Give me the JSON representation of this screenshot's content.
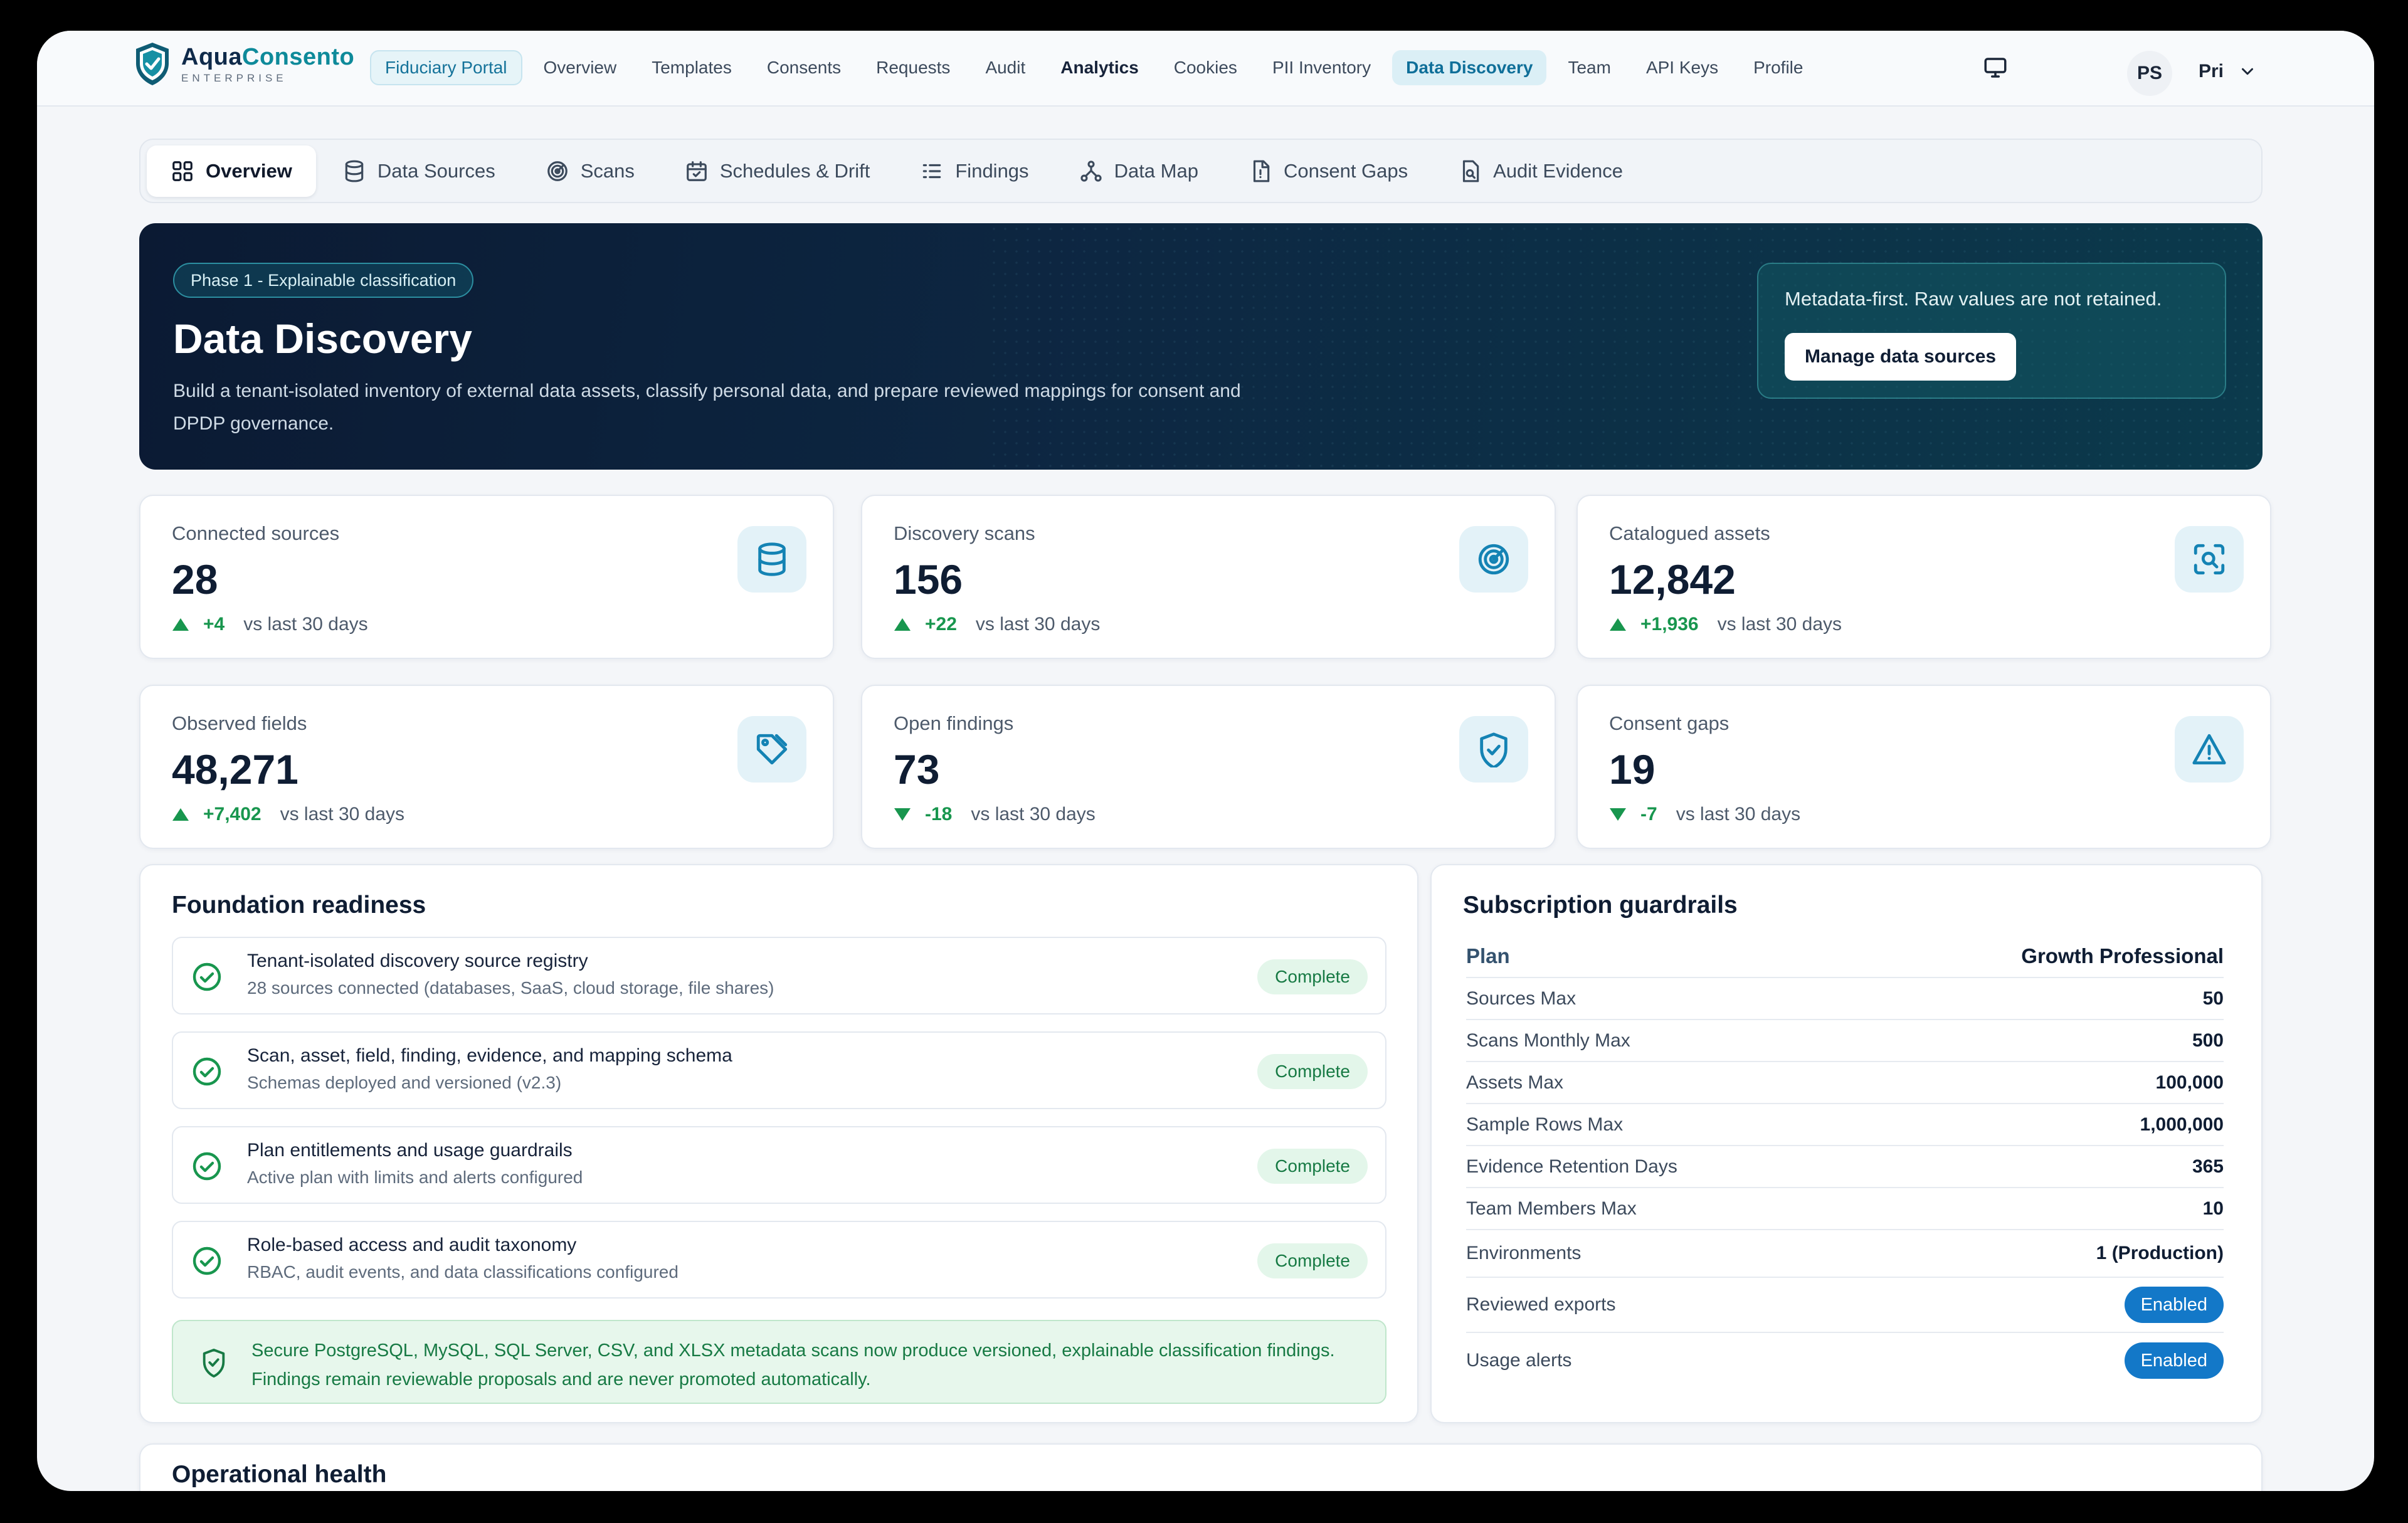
{
  "brand": {
    "name_a": "Aqua",
    "name_b": "Consento",
    "sub": "ENTERPRISE"
  },
  "nav": {
    "items": [
      {
        "label": "Fiduciary Portal",
        "style": "pill"
      },
      {
        "label": "Overview",
        "style": ""
      },
      {
        "label": "Templates",
        "style": ""
      },
      {
        "label": "Consents",
        "style": ""
      },
      {
        "label": "Requests",
        "style": ""
      },
      {
        "label": "Audit",
        "style": ""
      },
      {
        "label": "Analytics",
        "style": "bold"
      },
      {
        "label": "Cookies",
        "style": ""
      },
      {
        "label": "PII Inventory",
        "style": ""
      },
      {
        "label": "Data Discovery",
        "style": "active"
      },
      {
        "label": "Team",
        "style": ""
      },
      {
        "label": "API Keys",
        "style": ""
      },
      {
        "label": "Profile",
        "style": ""
      }
    ],
    "avatar": "PS",
    "user": "Pri"
  },
  "subtabs": [
    {
      "label": "Overview",
      "icon": "grid-icon",
      "active": true
    },
    {
      "label": "Data Sources",
      "icon": "database-icon",
      "active": false
    },
    {
      "label": "Scans",
      "icon": "radar-icon",
      "active": false
    },
    {
      "label": "Schedules & Drift",
      "icon": "calendar-icon",
      "active": false
    },
    {
      "label": "Findings",
      "icon": "list-icon",
      "active": false
    },
    {
      "label": "Data Map",
      "icon": "network-icon",
      "active": false
    },
    {
      "label": "Consent Gaps",
      "icon": "document-alert-icon",
      "active": false
    },
    {
      "label": "Audit Evidence",
      "icon": "evidence-icon",
      "active": false
    }
  ],
  "hero": {
    "badge": "Phase 1 - Explainable classification",
    "title": "Data Discovery",
    "desc": "Build a tenant-isolated inventory of external data assets, classify personal data, and prepare reviewed mappings for consent and DPDP governance.",
    "card_text": "Metadata-first. Raw values are not retained.",
    "card_button": "Manage data sources"
  },
  "stats": [
    {
      "label": "Connected sources",
      "value": "28",
      "delta": "+4",
      "direction": "up",
      "period": "vs last 30 days",
      "icon": "database-icon"
    },
    {
      "label": "Discovery scans",
      "value": "156",
      "delta": "+22",
      "direction": "up",
      "period": "vs last 30 days",
      "icon": "radar-icon"
    },
    {
      "label": "Catalogued assets",
      "value": "12,842",
      "delta": "+1,936",
      "direction": "up",
      "period": "vs last 30 days",
      "icon": "scan-search-icon"
    },
    {
      "label": "Observed fields",
      "value": "48,271",
      "delta": "+7,402",
      "direction": "up",
      "period": "vs last 30 days",
      "icon": "tag-icon"
    },
    {
      "label": "Open findings",
      "value": "73",
      "delta": "-18",
      "direction": "down",
      "period": "vs last 30 days",
      "icon": "shield-check-icon"
    },
    {
      "label": "Consent gaps",
      "value": "19",
      "delta": "-7",
      "direction": "down",
      "period": "vs last 30 days",
      "icon": "warning-icon"
    }
  ],
  "readiness": {
    "title": "Foundation readiness",
    "items": [
      {
        "title": "Tenant-isolated discovery source registry",
        "sub": "28 sources connected (databases, SaaS, cloud storage, file shares)",
        "status": "Complete"
      },
      {
        "title": "Scan, asset, field, finding, evidence, and mapping schema",
        "sub": "Schemas deployed and versioned (v2.3)",
        "status": "Complete"
      },
      {
        "title": "Plan entitlements and usage guardrails",
        "sub": "Active plan with limits and alerts configured",
        "status": "Complete"
      },
      {
        "title": "Role-based access and audit taxonomy",
        "sub": "RBAC, audit events, and data classifications configured",
        "status": "Complete"
      }
    ],
    "note": "Secure PostgreSQL, MySQL, SQL Server, CSV, and XLSX metadata scans now produce versioned, explainable classification findings. Findings remain reviewable proposals and are never promoted automatically."
  },
  "guardrails": {
    "title": "Subscription guardrails",
    "plan_label": "Plan",
    "plan_value": "Growth Professional",
    "rows": [
      {
        "k": "Sources Max",
        "v": "50"
      },
      {
        "k": "Scans Monthly Max",
        "v": "500"
      },
      {
        "k": "Assets Max",
        "v": "100,000"
      },
      {
        "k": "Sample Rows Max",
        "v": "1,000,000"
      },
      {
        "k": "Evidence Retention Days",
        "v": "365"
      },
      {
        "k": "Team Members Max",
        "v": "10"
      },
      {
        "k": "Environments",
        "v": "1 (Production)"
      }
    ],
    "toggles": [
      {
        "k": "Reviewed exports",
        "v": "Enabled"
      },
      {
        "k": "Usage alerts",
        "v": "Enabled"
      }
    ]
  },
  "operational": {
    "title": "Operational health"
  },
  "colors": {
    "accent": "#0e8a9a",
    "up": "#18964e",
    "enabled": "#1378c8",
    "hero_bg": "#0b1a33"
  }
}
